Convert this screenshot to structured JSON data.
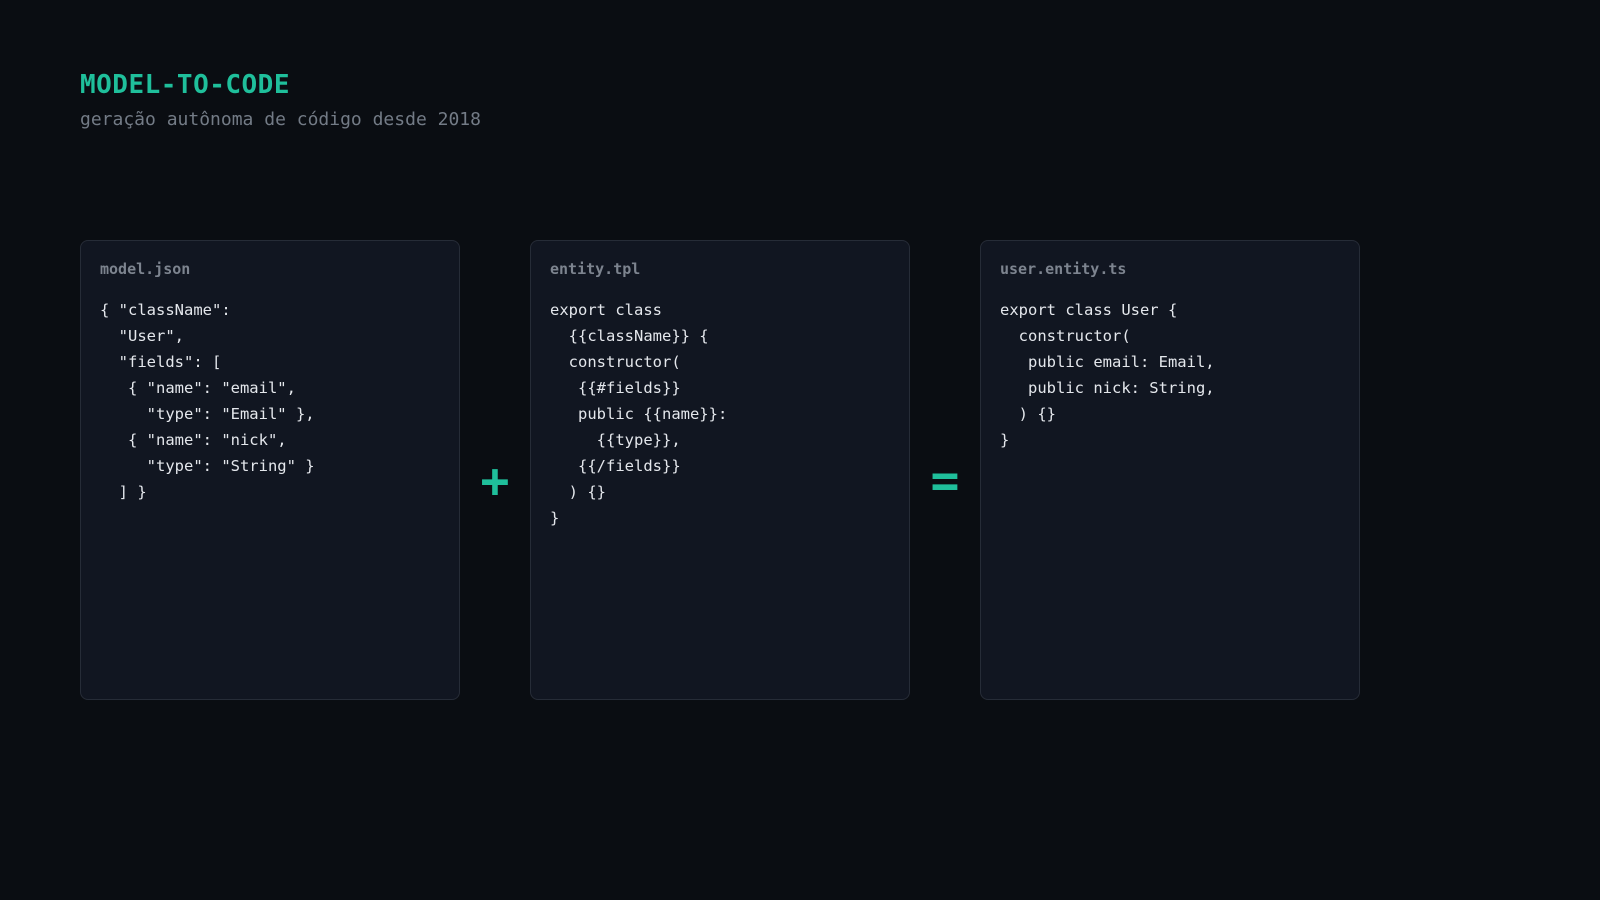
{
  "header": {
    "title": "MODEL-TO-CODE",
    "subtitle": "geração autônoma de código desde 2018"
  },
  "panels": [
    {
      "label": "model.json",
      "lines": [
        "{ \"className\":",
        "  \"User\",",
        "  \"fields\": [",
        "   { \"name\": \"email\",",
        "     \"type\": \"Email\" },",
        "   { \"name\": \"nick\",",
        "     \"type\": \"String\" }",
        "  ] }"
      ]
    },
    {
      "label": "entity.tpl",
      "lines": [
        "export class",
        "  {{className}} {",
        "  constructor(",
        "   {{#fields}}",
        "   public {{name}}:",
        "     {{type}},",
        "   {{/fields}}",
        "  ) {}",
        "}"
      ]
    },
    {
      "label": "user.entity.ts",
      "lines": [
        "export class User {",
        "  constructor(",
        "   public email: Email,",
        "   public nick: String,",
        "  ) {}",
        "}"
      ]
    }
  ],
  "operators": {
    "plus": "+",
    "equals": "="
  },
  "colors": {
    "accent": "#1fbf9b",
    "background": "#0a0d12",
    "panel": "#111621",
    "border": "#262c37"
  }
}
